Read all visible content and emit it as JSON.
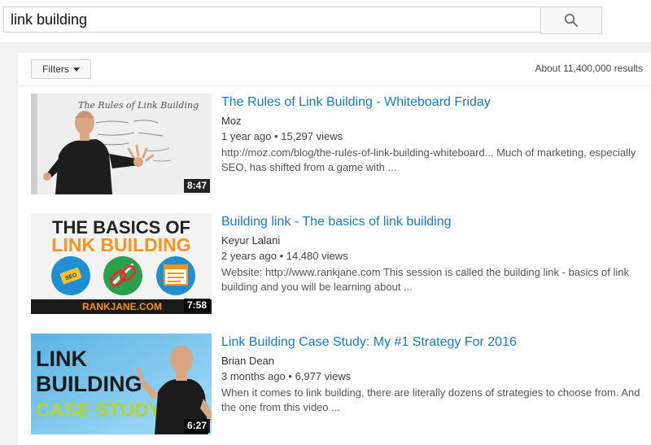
{
  "search": {
    "query": "link building"
  },
  "filters": {
    "label": "Filters"
  },
  "results_summary": "About 11,400,000 results",
  "colors": {
    "link": "#167ac6",
    "brand_orange": "#f7931e"
  },
  "results": [
    {
      "title": "The Rules of Link Building - Whiteboard Friday",
      "channel": "Moz",
      "age": "1 year ago",
      "views": "15,297 views",
      "description": "http://moz.com/blog/the-rules-of-link-building-whiteboard... Much of marketing, especially SEO, has shifted from a game with ...",
      "duration": "8:47",
      "thumb_text": "The Rules of Link Building"
    },
    {
      "title": "Building link - The basics of link building",
      "channel": "Keyur Lalani",
      "age": "2 years ago",
      "views": "14,480 views",
      "description": "Website: http://www.rankjane.com This session is called the building link - basics of link building and you will be learning about ...",
      "duration": "7:58",
      "thumb_line1": "THE BASICS OF",
      "thumb_line2": "LINK BUILDING",
      "thumb_footer": "RANKJANE.COM",
      "thumb_seo": "SEO"
    },
    {
      "title": "Link Building Case Study: My #1 Strategy For 2016",
      "channel": "Brian Dean",
      "age": "3 months ago",
      "views": "6,977 views",
      "description": "When it comes to link building, there are literally dozens of strategies to choose from. And the one from this video ...",
      "duration": "6:27",
      "thumb_line1": "LINK",
      "thumb_line2": "BUILDING",
      "thumb_line3": "CASE STUDY"
    }
  ]
}
